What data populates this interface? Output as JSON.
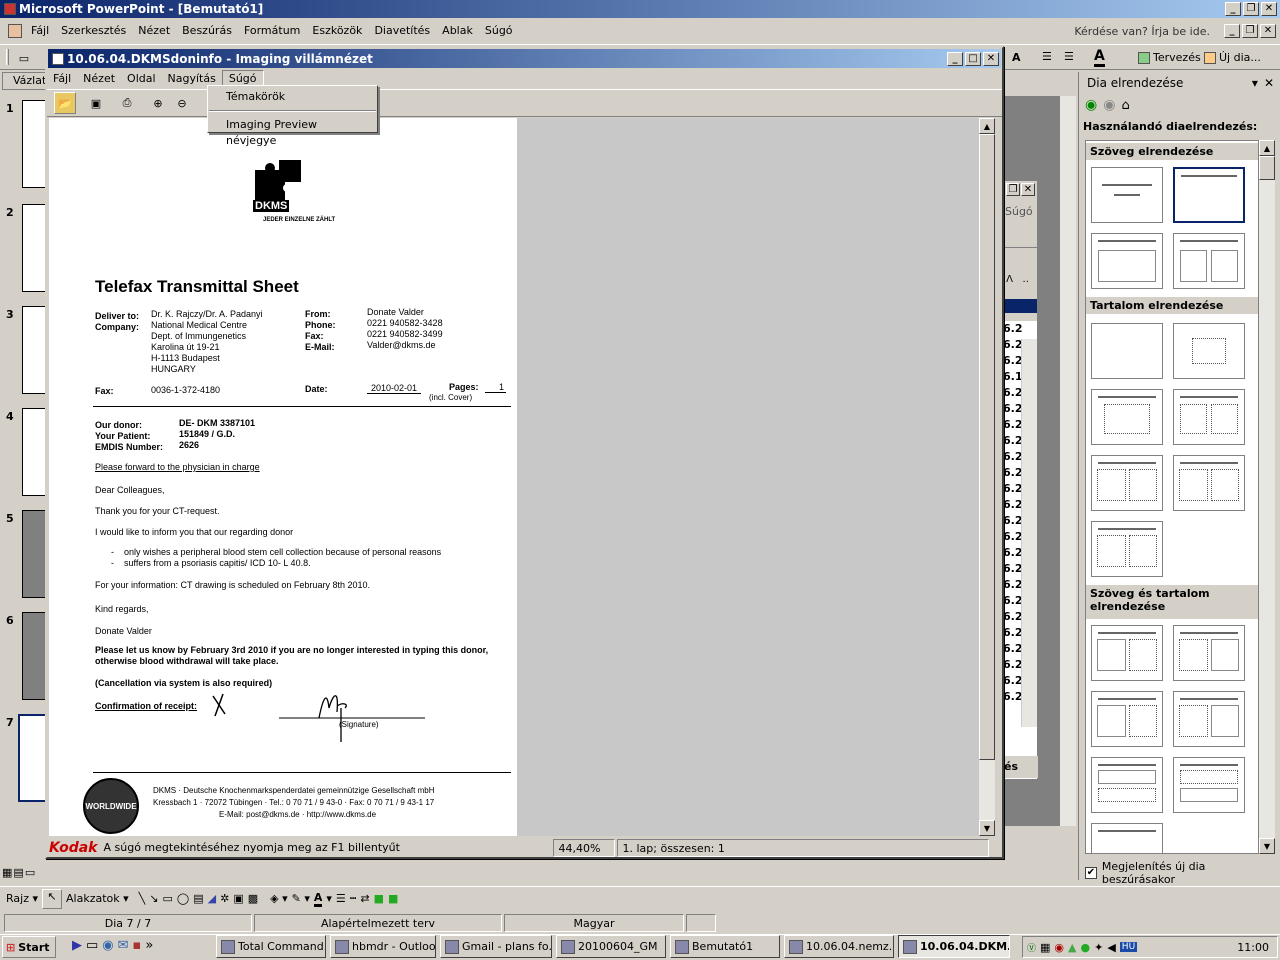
{
  "app": {
    "title": "Microsoft PowerPoint - [Bemutató1]",
    "menu": [
      "Fájl",
      "Szerkesztés",
      "Nézet",
      "Beszúrás",
      "Formátum",
      "Eszközök",
      "Diavetítés",
      "Ablak",
      "Súgó"
    ],
    "help_box": "Kérdése van? Írja be ide.",
    "toolbar_right": {
      "design": "Tervezés",
      "new_slide": "Új dia..."
    },
    "outline_tab": "Vázlat",
    "slide_numbers": [
      "1",
      "2",
      "3",
      "4",
      "5",
      "6",
      "7"
    ]
  },
  "viewer": {
    "title": "10.06.04.DKMSdoninfo - Imaging villámnézet",
    "menu": [
      "Fájl",
      "Nézet",
      "Oldal",
      "Nagyítás",
      "Súgó"
    ],
    "help_menu": [
      "Témakörök",
      "Imaging Preview névjegye"
    ],
    "status_text": "A súgó megtekintéséhez nyomja meg az F1 billentyűt",
    "zoom": "44,40%",
    "page_info": "1. lap; összesen: 1",
    "brand": "Kodak"
  },
  "fax": {
    "logo_text": "DKMS",
    "slogan": "JEDER EINZELNE ZÄHLT",
    "heading": "Telefax Transmittal Sheet",
    "deliver_label": "Deliver to:",
    "company_label": "Company:",
    "deliver_lines": [
      "Dr. K. Rajczy/Dr. A. Padanyi",
      "National Medical Centre",
      "Dept. of Immungenetics",
      "Karolina út 19-21",
      "H-1113 Budapest",
      "HUNGARY"
    ],
    "from_labels": [
      "From:",
      "Phone:",
      "Fax:",
      "E-Mail:"
    ],
    "from_values": [
      "Donate Valder",
      "0221 940582-3428",
      "0221 940582-3499",
      "Valder@dkms.de"
    ],
    "fax_label": "Fax:",
    "fax_value": "0036-1-372-4180",
    "date_label": "Date:",
    "date_value": "2010-02-01",
    "pages_label": "Pages:",
    "pages_value": "1",
    "incl_cover": "(incl. Cover)",
    "donor_labels": [
      "Our donor:",
      "Your Patient:",
      "EMDIS Number:"
    ],
    "donor_values": [
      "DE- DKM 3387101",
      "151849 / G.D.",
      "2626"
    ],
    "forward": "Please forward to the physician in charge",
    "greeting": "Dear Colleagues,",
    "thanks": "Thank you for your CT-request.",
    "inform": "I would like to inform you that our regarding donor",
    "bullet1": "only wishes a peripheral blood stem cell collection because of personal reasons",
    "bullet2": "suffers from a psoriasis capitis/ ICD 10- L 40.8.",
    "info": "For your information: CT drawing is scheduled on February 8th 2010.",
    "regards": "Kind regards,",
    "signer": "Donate Valder",
    "notice1": "Please let us know by February 3rd 2010 if you are no longer interested in typing this donor,",
    "notice2": "otherwise blood withdrawal will take place.",
    "cancel": "(Cancellation via system is also required)",
    "confirm": "Confirmation of receipt:",
    "signature": "(Signature)",
    "footer1": "DKMS · Deutsche Knochenmarkspenderdatei gemeinnützige Gesellschaft mbH",
    "footer2": "Kressbach 1 · 72072 Tübingen · Tel.: 0 70 71 / 9 43-0 · Fax: 0 70 71 / 9 43-1 17",
    "footer3": "E-Mail: post@dkms.de · http://www.dkms.de",
    "seal": "WORLDWIDE"
  },
  "task_pane": {
    "title": "Dia elrendezése",
    "apply": "Használandó diaelrendezés:",
    "sections": [
      "Szöveg elrendezése",
      "Tartalom elrendezése",
      "Szöveg és tartalom elrendezése"
    ],
    "show_on_insert": "Megjelenítés új dia beszúrásakor"
  },
  "behind_window": {
    "sugo": "Súgó",
    "es": "és",
    "values": [
      "6.2",
      "6.2",
      "6.2",
      "6.1",
      "6.2",
      "6.2",
      "6.2",
      "6.2",
      "6.2",
      "6.2",
      "6.2",
      "6.2",
      "6.2",
      "6.2",
      "6.2",
      "6.2",
      "6.2",
      "6.2",
      "6.2",
      "6.2",
      "6.2",
      "6.2",
      "6.2",
      "6.2"
    ]
  },
  "drawing": {
    "rajz": "Rajz",
    "alakzatok": "Alakzatok"
  },
  "status": {
    "slide": "Dia 7 / 7",
    "design": "Alapértelmezett terv",
    "lang": "Magyar"
  },
  "taskbar": {
    "start": "Start",
    "tasks": [
      "Total Command...",
      "hbmdr - Outloo...",
      "Gmail - plans fo...",
      "20100604_GM",
      "Bemutató1",
      "10.06.04.nemz...",
      "10.06.04.DKM..."
    ],
    "lang": "HU",
    "clock": "11:00"
  }
}
